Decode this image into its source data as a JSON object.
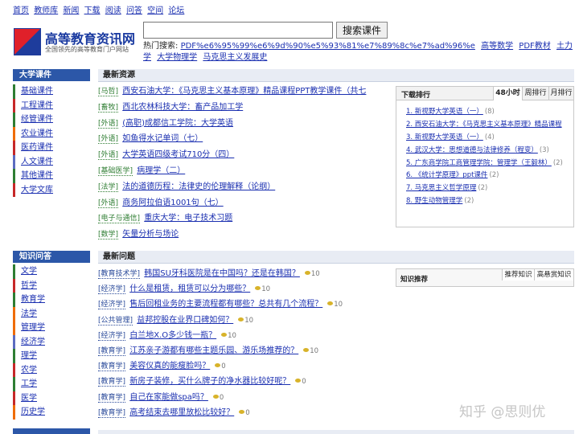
{
  "topnav": [
    "首页",
    "教师库",
    "新闻",
    "下载",
    "阅读",
    "问答",
    "空间",
    "论坛"
  ],
  "site": {
    "title": "高等教育资讯网",
    "subtitle": "全国领先的高等教育门户网站"
  },
  "search": {
    "value": "",
    "button": "搜索课件"
  },
  "hot": {
    "label": "热门搜索:",
    "items": [
      "PDF%e6%95%99%e6%9d%90%e5%93%81%e7%89%8c%e7%ad%96%e",
      "高等数学",
      "PDF教材",
      "土力学",
      "大学物理学",
      "马克思主义发展史"
    ]
  },
  "sidebar_courses": {
    "title": "大学课件",
    "items": [
      "基础课件",
      "工程课件",
      "经管课件",
      "农业课件",
      "医药课件",
      "人文课件",
      "其他课件",
      "大学文库"
    ]
  },
  "latest_resources": {
    "title": "最新资源",
    "rows": [
      {
        "tag": "[马哲]",
        "text": "西安石油大学：《马克思主义基本原理》精品课程PPT教学课件（共七"
      },
      {
        "tag": "[畜牧]",
        "text": "西北农林科技大学：畜产品加工学"
      },
      {
        "tag": "[外语]",
        "text": "(高职)成都信工学院：大学英语"
      },
      {
        "tag": "[外语]",
        "text": "如鱼得水记单词（七）"
      },
      {
        "tag": "[外语]",
        "text": "大学英语四级考试710分（四）"
      },
      {
        "tag": "[基础医学]",
        "text": "病理学（二）"
      },
      {
        "tag": "[法学]",
        "text": "法的道德历程：法律史的伦理解释（论纲）"
      },
      {
        "tag": "[外语]",
        "text": "商务阿拉伯语1001句（七）"
      },
      {
        "tag": "[电子与通信]",
        "text": "重庆大学：电子技术习题"
      },
      {
        "tag": "[数学]",
        "text": "矢量分析与场论"
      }
    ]
  },
  "rank": {
    "title": "下载排行",
    "tabs": [
      "48小时",
      "周排行",
      "月排行"
    ],
    "items": [
      {
        "text": "1. 新视野大学英语（一）",
        "count": "(8)"
      },
      {
        "text": "2. 西安石油大学：《马克思主义基本原理》精品课程",
        "count": ""
      },
      {
        "text": "3. 新视野大学英语（一）",
        "count": "(4)"
      },
      {
        "text": "4. 武汉大学：思想道德与法律修养（程变）",
        "count": "(3)"
      },
      {
        "text": "5. 广东商学院工商管理学院：管理学（王毅林）",
        "count": "(2)"
      },
      {
        "text": "6. 《统计学原理》ppt课件",
        "count": "(2)"
      },
      {
        "text": "7. 马克思主义哲学原理",
        "count": "(2)"
      },
      {
        "text": "8. 野生动物管理学",
        "count": "(2)"
      }
    ]
  },
  "sidebar_qa": {
    "title": "知识问答",
    "items": [
      "文学",
      "哲学",
      "教育学",
      "法学",
      "管理学",
      "经济学",
      "理学",
      "农学",
      "工学",
      "医学",
      "历史学"
    ]
  },
  "latest_questions": {
    "title": "最新问题",
    "rows": [
      {
        "tag": "[教育技术学]",
        "text": "韩国SU牙科医院是在中国吗？还是在韩国？",
        "coin": "10"
      },
      {
        "tag": "[经济学]",
        "text": "什么是租赁，租赁可以分为哪些？",
        "coin": "10"
      },
      {
        "tag": "[经济学]",
        "text": "售后回租业务的主要流程都有哪些？总共有几个流程？",
        "coin": "10"
      },
      {
        "tag": "[公共管理]",
        "text": "益邦控股在业界口碑如何？",
        "coin": "10"
      },
      {
        "tag": "[经济学]",
        "text": "白兰地X.O多少钱一瓶？",
        "coin": "10"
      },
      {
        "tag": "[教育学]",
        "text": "江苏亲子游都有哪些主题乐园、游乐场推荐的？",
        "coin": "10"
      },
      {
        "tag": "[教育学]",
        "text": "美容仪真的能瘦脸吗？",
        "coin": "0"
      },
      {
        "tag": "[教育学]",
        "text": "新房子装修，买什么牌子的净水器比较好呢？",
        "coin": "0"
      },
      {
        "tag": "[教育学]",
        "text": "自己在家能做spa吗？",
        "coin": "0"
      },
      {
        "tag": "[教育学]",
        "text": "高考结束去哪里放松比较好？",
        "coin": "0"
      }
    ]
  },
  "qa_box": {
    "title": "知识推荐",
    "tabs": [
      "推荐知识",
      "高悬赏知识"
    ]
  },
  "watermark": "知乎 @思则优"
}
